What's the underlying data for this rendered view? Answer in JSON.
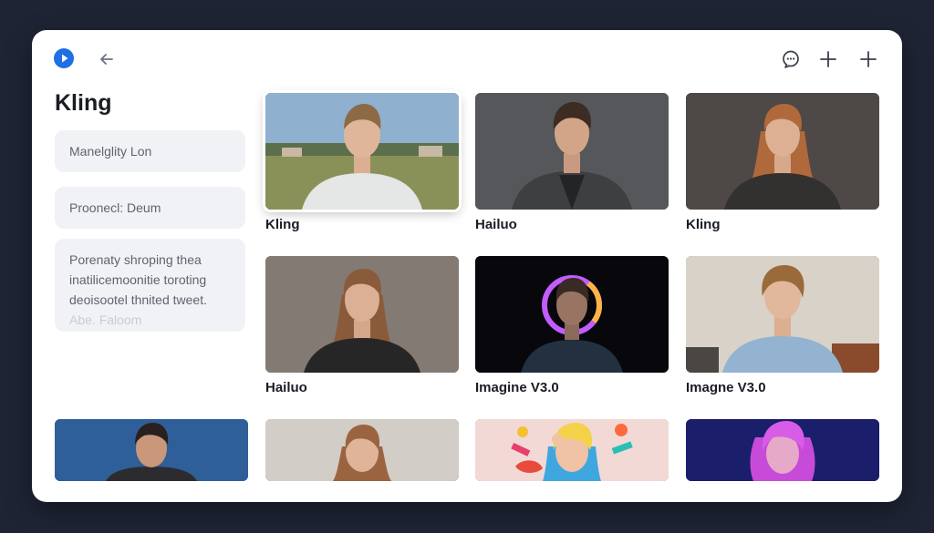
{
  "app": {
    "title": "Kling"
  },
  "toolbar": {
    "logo_icon": "play-circle-icon",
    "back_icon": "arrow-left-icon",
    "chat_icon": "chat-bubble-icon",
    "add_icon": "plus-icon",
    "new_icon": "plus-icon"
  },
  "sidebar": {
    "fields": [
      {
        "text": "Manelglity Lon"
      },
      {
        "text": "Proonecl: Deum"
      }
    ],
    "description": {
      "line1": "Porenaty shroping thea",
      "line2": "inatilicemoonitie toroting",
      "line3": "deoisootel thnited tweet.",
      "muted": "Abe. Faloom"
    }
  },
  "grid": {
    "items": [
      {
        "label": "Kling"
      },
      {
        "label": "Hailuo"
      },
      {
        "label": "Kling"
      },
      {
        "label": "Hailuo"
      },
      {
        "label": "Imagine V3.0"
      },
      {
        "label": "Imagne V3.0"
      }
    ]
  },
  "colors": {
    "accent": "#1f6fe5",
    "page_bg": "#1e2434",
    "panel_bg": "#ffffff",
    "field_bg": "#f1f2f5"
  }
}
